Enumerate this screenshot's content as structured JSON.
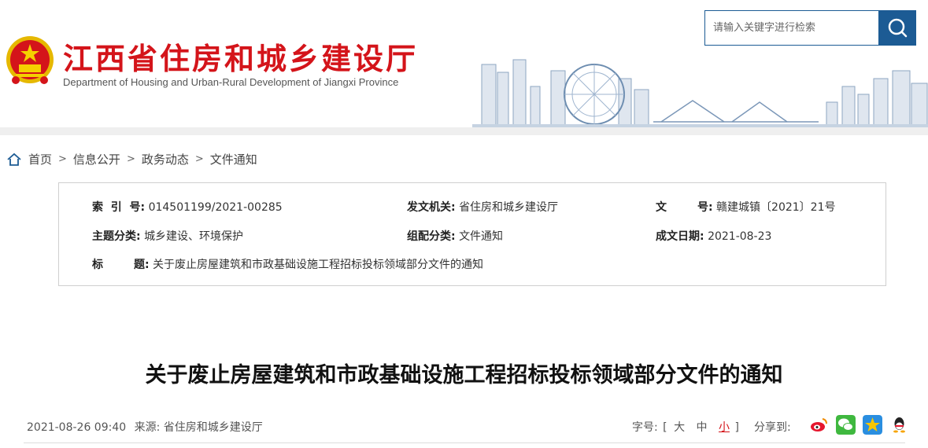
{
  "header": {
    "title": "江西省住房和城乡建设厅",
    "subtitle": "Department of Housing and Urban-Rural Development of Jiangxi Province",
    "emblem_icon": "national-emblem-icon",
    "search": {
      "placeholder": "请输入关键字进行检索",
      "button_icon": "search-icon"
    },
    "colors": {
      "brand_red": "#d4141a",
      "brand_blue": "#1c5b94"
    }
  },
  "breadcrumb": {
    "home_icon": "home-icon",
    "items": [
      "首页",
      "信息公开",
      "政务动态",
      "文件通知"
    ],
    "separator": ">"
  },
  "meta": {
    "index_label": "索  引  号:",
    "index_value": "014501199/2021-00285",
    "issuer_label": "发文机关:",
    "issuer_value": "省住房和城乡建设厅",
    "docno_label": "文        号:",
    "docno_value": "赣建城镇〔2021〕21号",
    "topic_label": "主题分类:",
    "topic_value": "城乡建设、环境保护",
    "category_label": "组配分类:",
    "category_value": "文件通知",
    "date_label": "成文日期:",
    "date_value": "2021-08-23",
    "title_label": "标        题:",
    "title_value": "关于废止房屋建筑和市政基础设施工程招标投标领域部分文件的通知"
  },
  "article": {
    "title": "关于废止房屋建筑和市政基础设施工程招标投标领域部分文件的通知",
    "datetime": "2021-08-26 09:40",
    "source_label": "来源:",
    "source_value": "省住房和城乡建设厅",
    "fontsize_label": "字号:",
    "fontsize_open": "[",
    "fontsize_large": "大",
    "fontsize_medium": "中",
    "fontsize_small": "小",
    "fontsize_close": "]",
    "share_label": "分享到:",
    "share_icons": [
      "weibo-icon",
      "wechat-icon",
      "qzone-icon",
      "qq-icon"
    ]
  }
}
